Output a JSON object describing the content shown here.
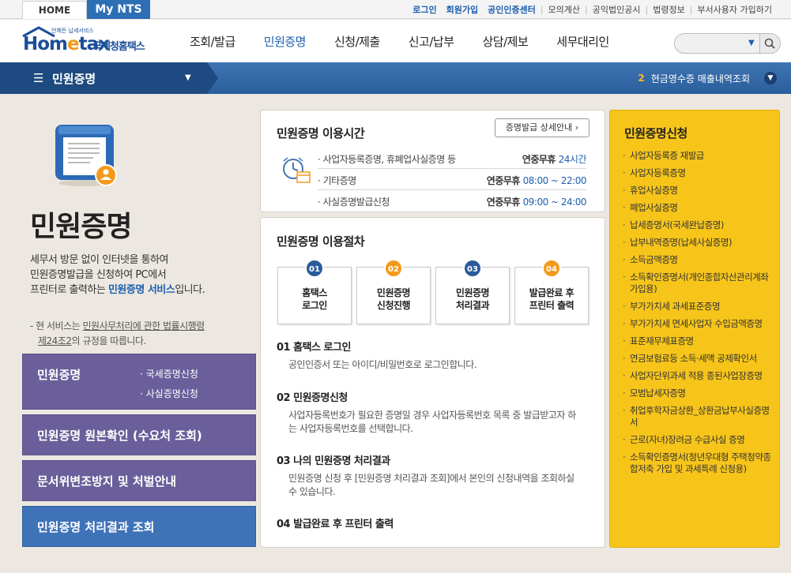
{
  "topbar": {
    "home_tab": "HOME",
    "mynts_tab": "My NTS",
    "links": [
      "로그인",
      "회원가입",
      "공인인증센터",
      "모의계산",
      "공익법인공시",
      "법령정보",
      "부서사용자 가입하기"
    ]
  },
  "header": {
    "logo_en": "Hometax",
    "logo_kr": "국세청홈택스",
    "logo_small": "언제든 납세서비스",
    "nav": [
      "조회/발급",
      "민원증명",
      "신청/제출",
      "신고/납부",
      "상담/제보",
      "세무대리인"
    ]
  },
  "navbar": {
    "title": "민원증명",
    "notice_num": "2",
    "notice_text": "현금영수증 매출내역조회"
  },
  "left": {
    "title": "민원증명",
    "desc_1": "세무서 방문 없이 인터넷을 통하여",
    "desc_2": "민원증명발급을 신청하여 PC에서",
    "desc_3a": "프린터로 출력하는 ",
    "desc_3b": "민원증명 서비스",
    "desc_3c": "입니다.",
    "notice_a": "현 서비스는 ",
    "notice_b": "민원사무처리에 관한 법률시행령",
    "notice_c": "제24조2",
    "notice_d": "의 규정을 따릅니다.",
    "menus": [
      {
        "label": "민원증명",
        "subs": [
          "국세증명신청",
          "사실증명신청"
        ]
      },
      {
        "label": "민원증명 원본확인 (수요처 조회)"
      },
      {
        "label": "문서위변조방지 및 처벌안내"
      },
      {
        "label": "민원증명 처리결과 조회"
      }
    ]
  },
  "hours": {
    "title": "민원증명 이용시간",
    "detail_button": "증명발급 상세안내",
    "rows": [
      {
        "label": "사업자등록증명, 휴폐업사실증명 등",
        "prefix": "연중무휴",
        "value": "24시간"
      },
      {
        "label": "기타증명",
        "prefix": "연중무휴",
        "value": "08:00 ~ 22:00"
      },
      {
        "label": "사실증명발급신청",
        "prefix": "연중무휴",
        "value": "09:00 ~ 24:00"
      }
    ]
  },
  "procedure": {
    "title": "민원증명 이용절차",
    "steps": [
      {
        "num": "01",
        "line1": "홈택스",
        "line2": "로그인"
      },
      {
        "num": "02",
        "line1": "민원증명",
        "line2": "신청진행"
      },
      {
        "num": "03",
        "line1": "민원증명",
        "line2": "처리결과"
      },
      {
        "num": "04",
        "line1": "발급완료 후",
        "line2": "프린터 출력"
      }
    ],
    "sections": [
      {
        "heading": "01 홈택스 로그인",
        "body": "공인인증서 또는 아이디/비밀번호로 로그인합니다."
      },
      {
        "heading": "02 민원증명신청",
        "body": "사업자등록번호가 필요한 증명일 경우 사업자등록번호 목록 중 발급받고자 하는 사업자등록번호를 선택합니다."
      },
      {
        "heading": "03 나의 민원증명 처리결과",
        "body": "민원증명 신청 후 [민원증명 처리결과 조회]에서 본인의 신청내역을 조회하실 수 있습니다."
      },
      {
        "heading": "04 발급완료 후 프린터 출력",
        "body": ""
      }
    ]
  },
  "apply": {
    "title": "민원증명신청",
    "items": [
      "사업자등록증 재발급",
      "사업자등록증명",
      "휴업사실증명",
      "폐업사실증명",
      "납세증명서(국세완납증명)",
      "납부내역증명(납세사실증명)",
      "소득금액증명",
      "소득확인증명서(개인종합자산관리계좌 가입용)",
      "부가가치세 과세표준증명",
      "부가가치세 면세사업자 수입금액증명",
      "표준재무제표증명",
      "연금보험료등 소득·세액 공제확인서",
      "사업자단위과세 적용 종된사업장증명",
      "모범납세자증명",
      "취업후학자금상환_상환금납부사실증명서",
      "근로(자녀)장려금 수급사실 증명",
      "소득확인증명서(청년우대형 주택청약종합저축 가입 및 과세특례 신청용)"
    ]
  },
  "colors": {
    "brand_blue": "#2d6fb5",
    "purple_menu": "#6a5f9a",
    "yellow_panel": "#f7c51a",
    "orange_badge": "#f39a1c"
  }
}
